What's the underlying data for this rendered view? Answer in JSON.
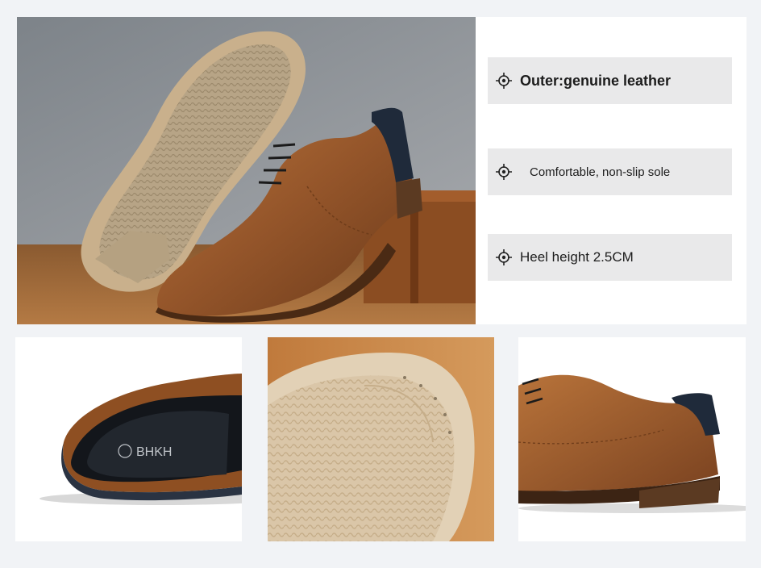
{
  "features": [
    {
      "label": "Outer:genuine leather",
      "icon": "crosshair-icon"
    },
    {
      "label": "Comfortable, non-slip sole",
      "icon": "crosshair-icon"
    },
    {
      "label": "Heel height 2.5CM",
      "icon": "crosshair-icon"
    }
  ],
  "insole_brand": "BHKH",
  "colors": {
    "page_background": "#f1f3f6",
    "feature_box": "#e9e9ea",
    "leather_brown": "#9a5a2a",
    "sole_tan": "#c9b292",
    "wood": "#a0642f"
  }
}
